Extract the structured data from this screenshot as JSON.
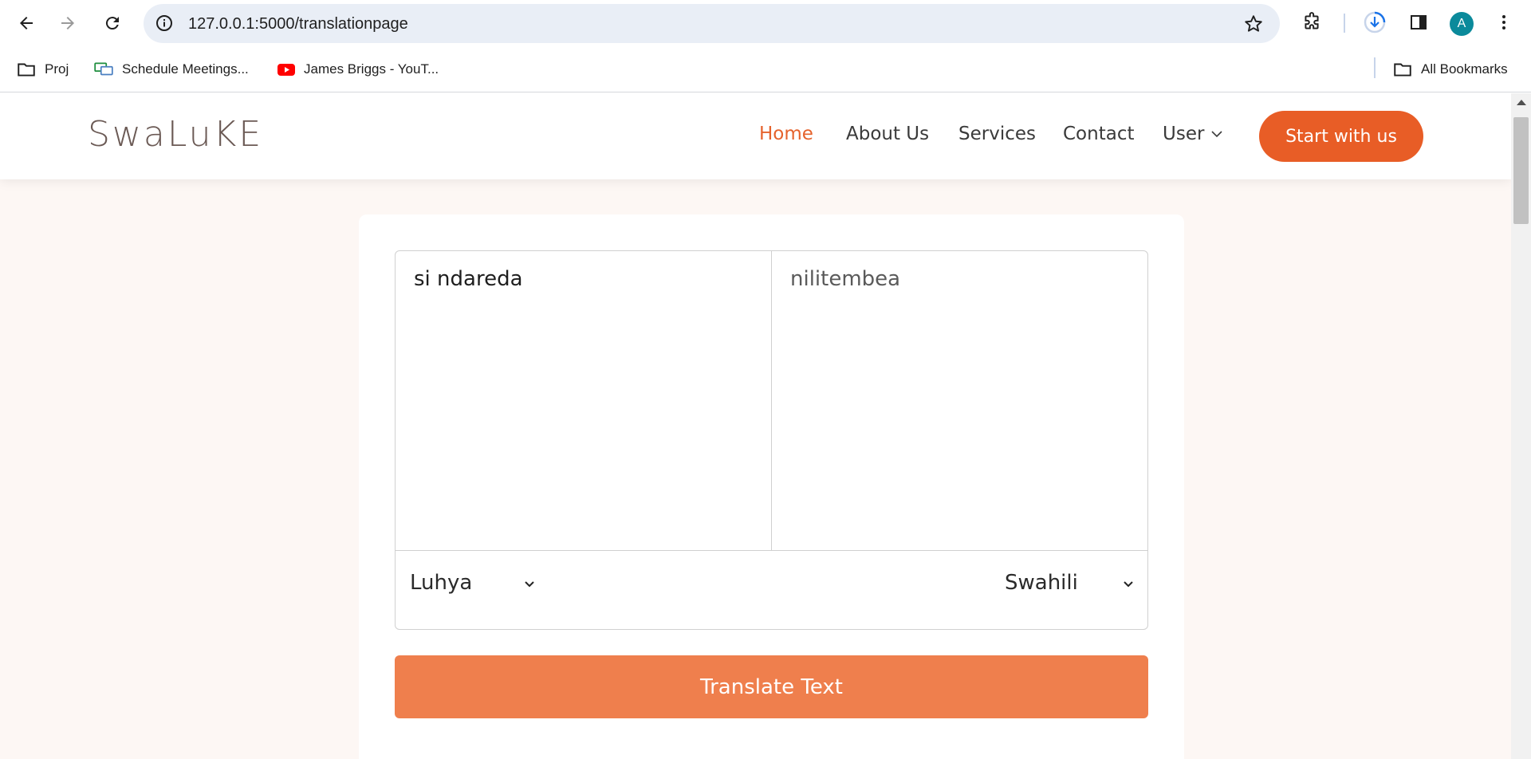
{
  "browser": {
    "url": "127.0.0.1:5000/translationpage",
    "avatar_letter": "A",
    "bookmarks": [
      {
        "label": "Proj",
        "icon": "folder-icon"
      },
      {
        "label": "Schedule Meetings...",
        "icon": "meetings-icon"
      },
      {
        "label": "James Briggs - YouT...",
        "icon": "youtube-icon"
      }
    ],
    "all_bookmarks_label": "All Bookmarks"
  },
  "site": {
    "logo": "SwaLuKE",
    "nav": {
      "home": "Home",
      "about": "About Us",
      "services": "Services",
      "contact": "Contact",
      "user": "User"
    },
    "cta_label": "Start with us",
    "accent_color": "#e85d26"
  },
  "translator": {
    "source_text": "si ndareda",
    "translated_text": "nilitembea",
    "source_language": "Luhya",
    "target_language": "Swahili",
    "button_label": "Translate Text",
    "button_color": "#ef7f4d"
  }
}
